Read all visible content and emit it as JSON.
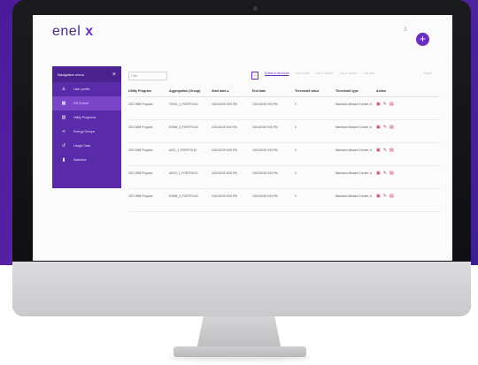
{
  "app": {
    "logo_text": "enel",
    "logo_x": "x",
    "fab": "+"
  },
  "nav": {
    "title": "Navigation menu",
    "close": "×",
    "items": [
      {
        "icon": "user-icon",
        "glyph": "♙",
        "label": "User profile"
      },
      {
        "icon": "calendar-icon",
        "glyph": "▦",
        "label": "DR Events"
      },
      {
        "icon": "building-icon",
        "glyph": "▥",
        "label": "Utility Programs"
      },
      {
        "icon": "share-icon",
        "glyph": "⋖",
        "label": "Energy Groups"
      },
      {
        "icon": "history-icon",
        "glyph": "↺",
        "label": "Usage Data"
      },
      {
        "icon": "stats-icon",
        "glyph": "▮",
        "label": "Statistics"
      }
    ]
  },
  "toolbar": {
    "search_placeholder": "Filter",
    "calendar_glyph": "▢",
    "filters": [
      "Events in the future",
      "Last month",
      "Last 3 months",
      "Last 6 months",
      "Last year"
    ],
    "export": "Export"
  },
  "table": {
    "headers": [
      "Utility Program",
      "Aggregation (Group)",
      "Start date ▴",
      "End date",
      "Threshold value",
      "Threshold type",
      "Action"
    ],
    "rows": [
      [
        "CEO 5/6B Program",
        "TOHO_3_PORTFOLIO",
        "10/24/2019 5:00 PM",
        "10/24/2019 9:00 PM",
        "0",
        "Maximum Allowed Current, A"
      ],
      [
        "CEO 5/6B Program",
        "EIVAN_3_PORTFOLIO",
        "10/24/2019 5:00 PM",
        "10/24/2019 9:00 PM",
        "0",
        "Maximum Allowed Current, A"
      ],
      [
        "CEO 5/6B Program",
        "AZIO_1_PORTFOLIO",
        "10/24/2019 5:00 PM",
        "10/24/2019 9:00 PM",
        "0",
        "Maximum Allowed Current, A"
      ],
      [
        "CEO 5/6B Program",
        "ASVO_1_PORTFOLIO",
        "10/24/2019 5:00 PM",
        "10/24/2019 9:00 PM",
        "0",
        "Maximum Allowed Current, A"
      ],
      [
        "CEO 5/6B Program",
        "EIVAN_3_PORTFOLIO",
        "10/24/2019 5:00 PM",
        "10/24/2019 9:00 PM",
        "0",
        "Maximum Allowed Current, A"
      ]
    ],
    "action_glyphs": {
      "details": "▣",
      "edit": "✎",
      "delete": "▤"
    }
  },
  "colors": {
    "brand": "#6a2fc1",
    "nav_bg": "#5a2ba8",
    "action": "#c43a6a"
  }
}
